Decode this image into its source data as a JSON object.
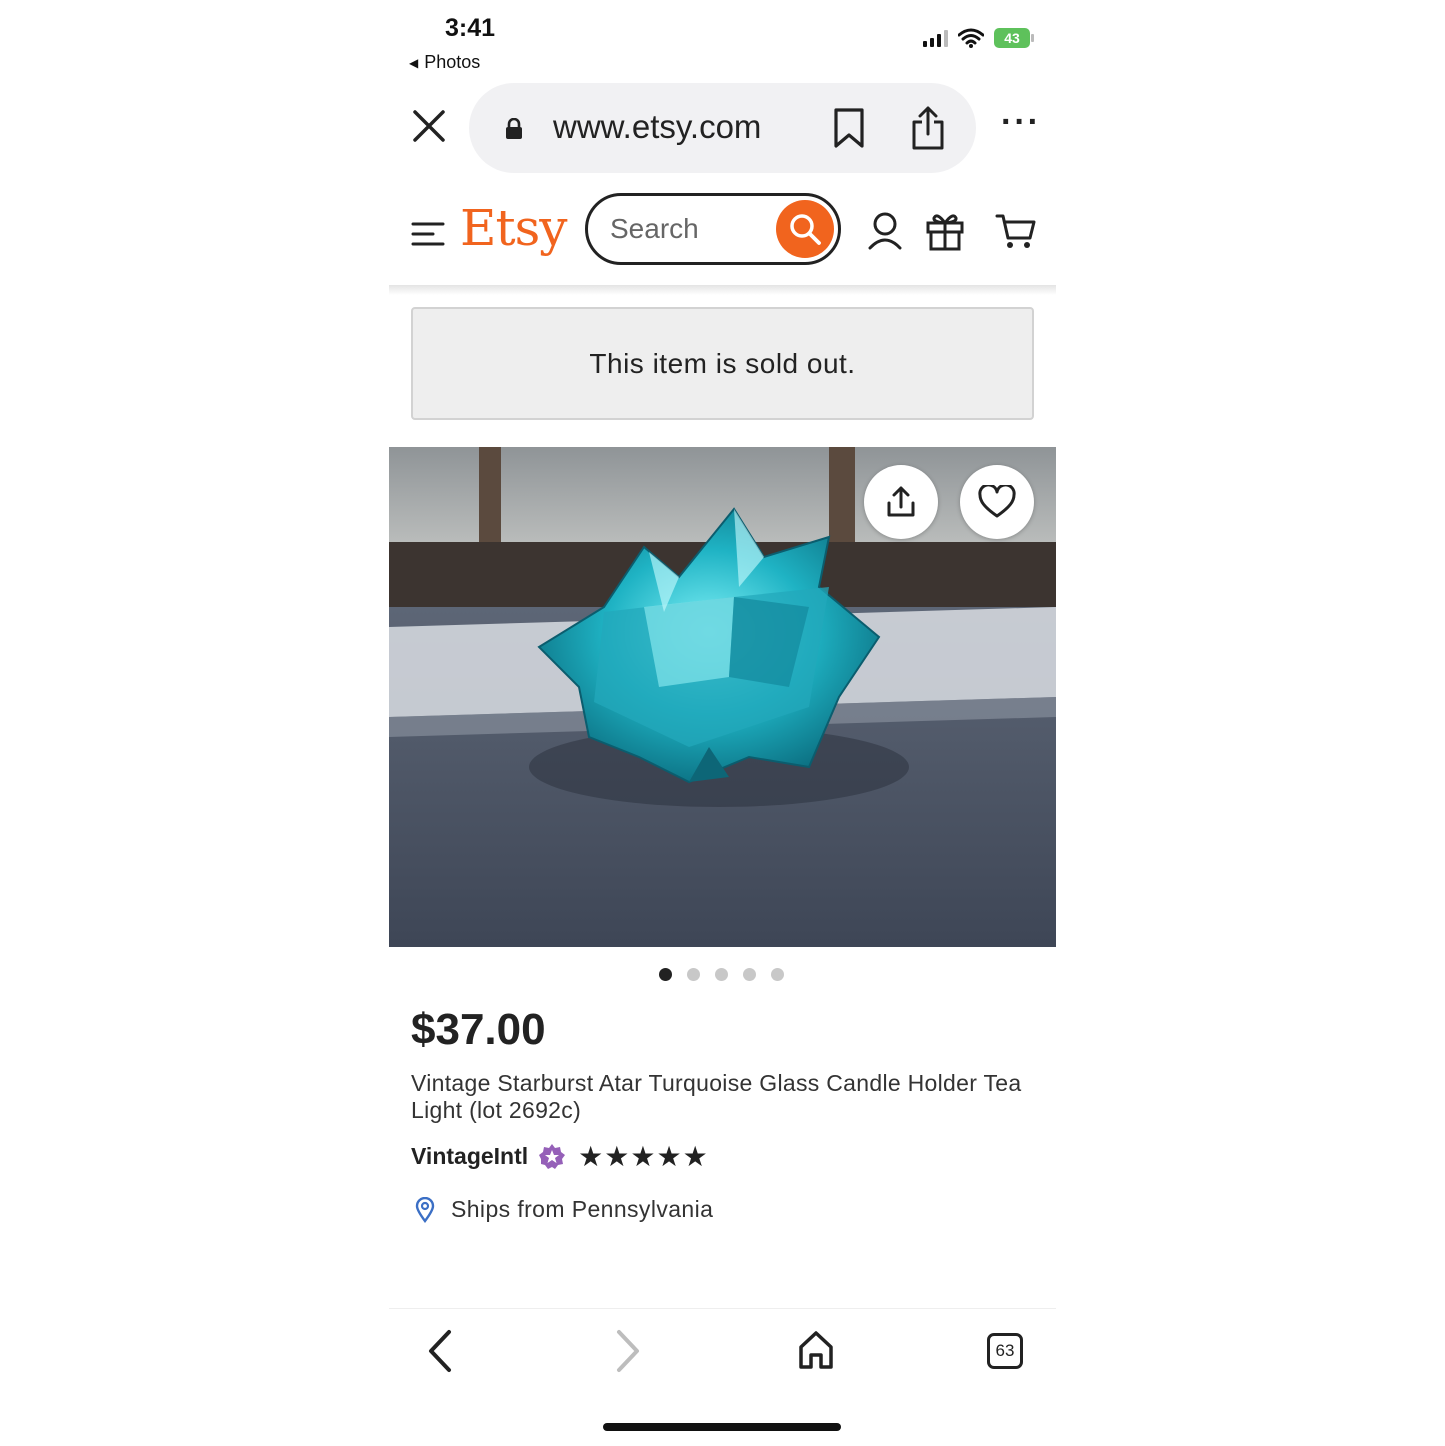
{
  "status_bar": {
    "time": "3:41",
    "back_app": "Photos",
    "battery": "43"
  },
  "browser": {
    "url": "www.etsy.com",
    "icons": [
      "close-icon",
      "lock-icon",
      "bookmark-icon",
      "share-icon",
      "more-icon"
    ]
  },
  "header": {
    "logo": "Etsy",
    "search_placeholder": "Search",
    "brand_color": "#f1641e",
    "icons": [
      "menu-icon",
      "search-icon",
      "account-icon",
      "gift-icon",
      "cart-icon"
    ]
  },
  "banner": {
    "text": "This item is sold out."
  },
  "gallery": {
    "image_count": 5,
    "active_index": 0
  },
  "product": {
    "price": "$37.00",
    "title": "Vintage Starburst Atar Turquoise Glass Candle Holder Tea Light (lot 2692c)",
    "shop_name": "VintageIntl",
    "rating_stars": "★★★★★",
    "rating": 5,
    "ships_from": "Ships from Pennsylvania"
  },
  "toolbar": {
    "tab_count": "63"
  }
}
